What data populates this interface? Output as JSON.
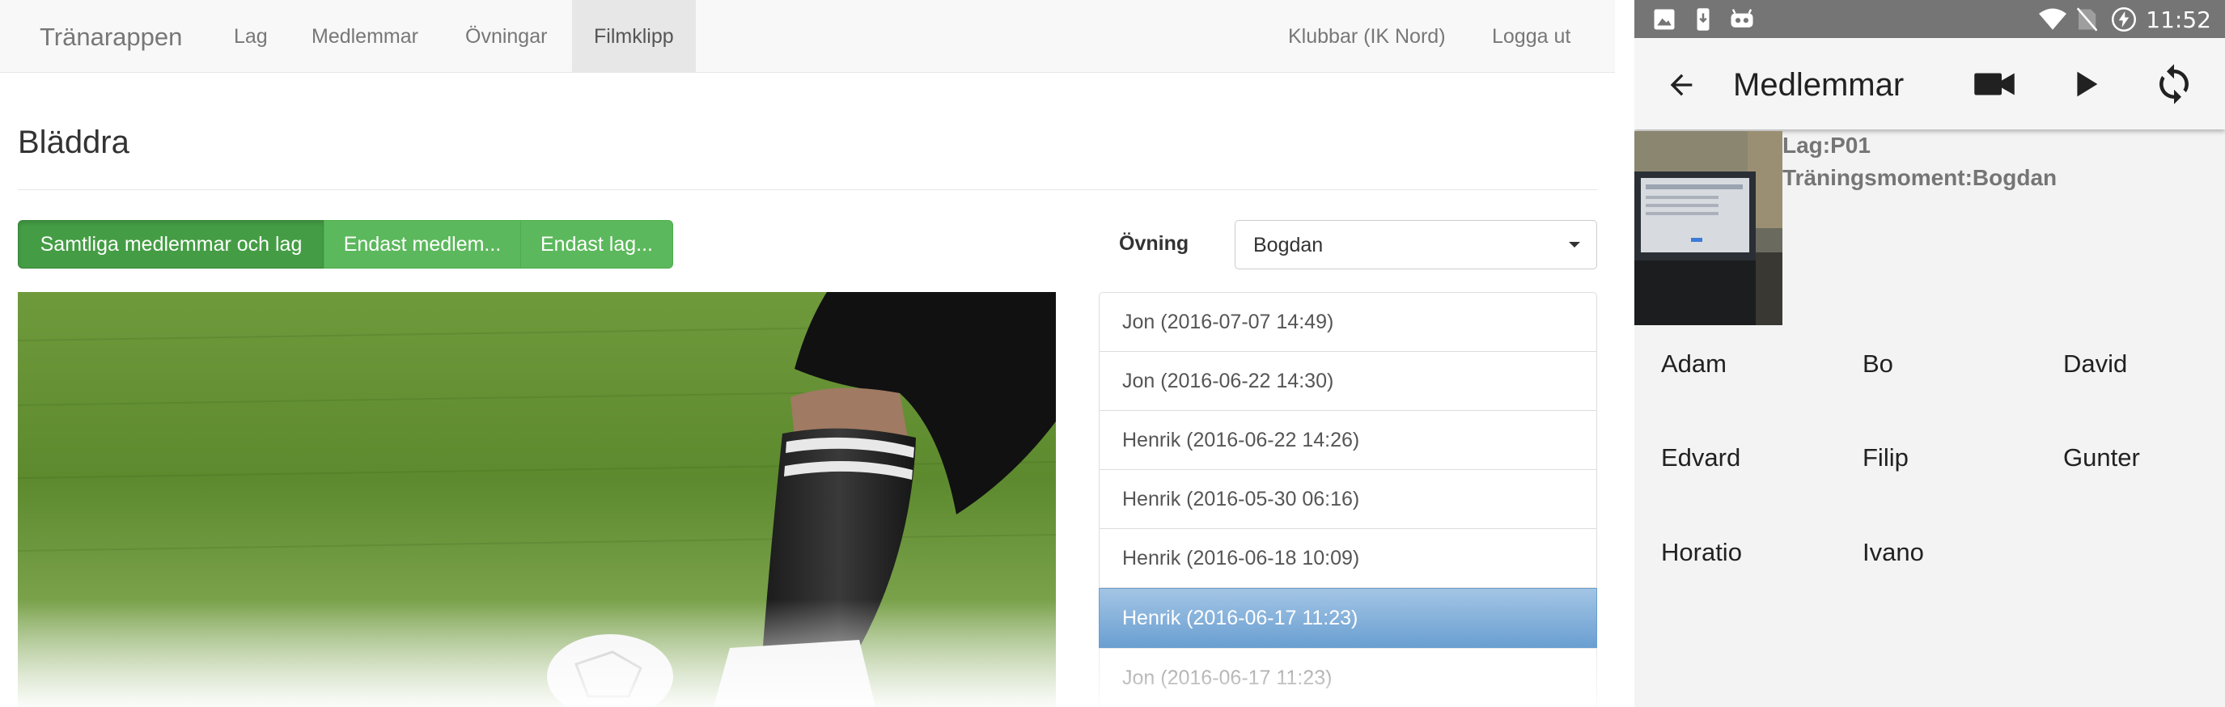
{
  "web": {
    "brand": "Tränarappen",
    "nav": [
      {
        "label": "Lag"
      },
      {
        "label": "Medlemmar"
      },
      {
        "label": "Övningar"
      },
      {
        "label": "Filmklipp",
        "active": true
      }
    ],
    "nav_right": [
      {
        "label": "Klubbar (IK Nord)"
      },
      {
        "label": "Logga ut"
      }
    ],
    "page_title": "Bläddra",
    "filter_buttons": [
      {
        "label": "Samtliga medlemmar och lag",
        "active": true
      },
      {
        "label": "Endast medlem..."
      },
      {
        "label": "Endast lag..."
      }
    ],
    "exercise_label": "Övning",
    "exercise_value": "Bogdan",
    "clips": [
      {
        "label": "Jon (2016-07-07 14:49)"
      },
      {
        "label": "Jon (2016-06-22 14:30)"
      },
      {
        "label": "Henrik (2016-06-22 14:26)"
      },
      {
        "label": "Henrik (2016-05-30 06:16)"
      },
      {
        "label": "Henrik (2016-06-18 10:09)"
      },
      {
        "label": "Henrik (2016-06-17 11:23)",
        "active": true
      },
      {
        "label": "Jon (2016-06-17 11:23)"
      }
    ],
    "colors": {
      "success": "#5cb85c",
      "success_active": "#449d44",
      "list_active": "#6a9fd1"
    }
  },
  "android": {
    "status_time": "11:52",
    "status_icons": [
      "image-icon",
      "phone-download-icon",
      "android-debug-icon",
      "wifi-icon",
      "no-sim-icon",
      "battery-charging-icon"
    ],
    "title": "Medlemmar",
    "actions": [
      "video-camera-icon",
      "play-icon",
      "sync-icon"
    ],
    "team_line": "Lag:P01",
    "exercise_line": "Träningsmoment:Bogdan",
    "members": [
      "Adam",
      "Bo",
      "David",
      "Edvard",
      "Filip",
      "Gunter",
      "Horatio",
      "Ivano"
    ],
    "colors": {
      "statusbar": "#757575",
      "appbar": "#f5f5f5"
    }
  }
}
